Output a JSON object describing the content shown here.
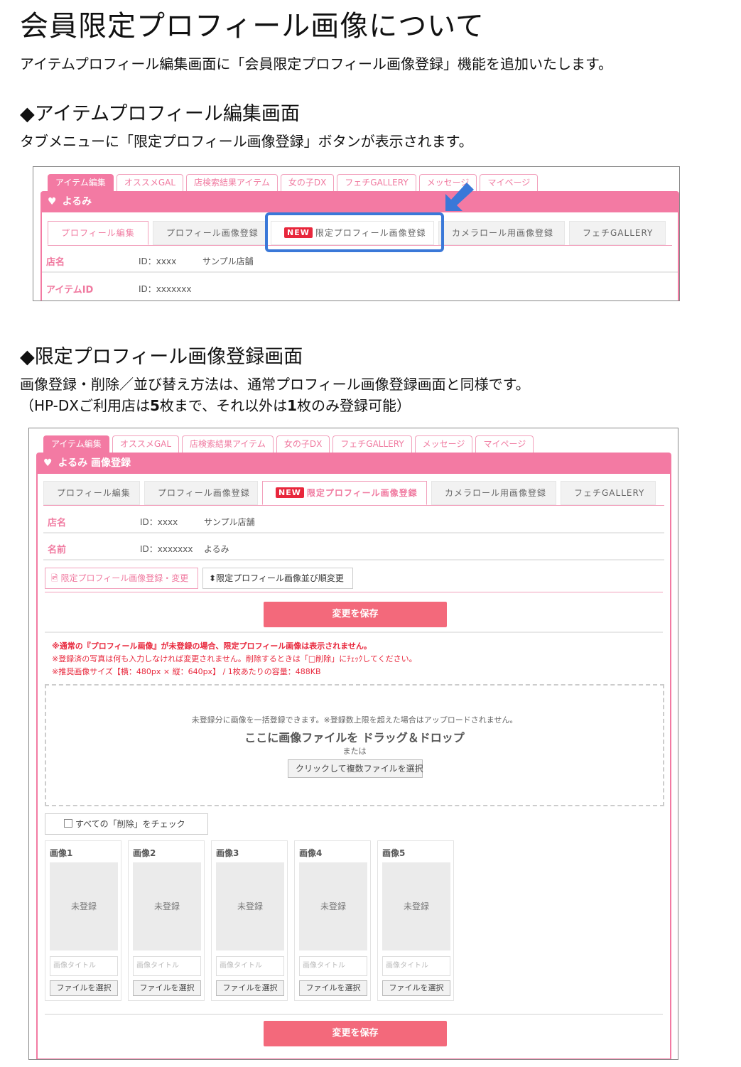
{
  "title": "会員限定プロフィール画像について",
  "intro": "アイテムプロフィール編集画面に「会員限定プロフィール画像登録」機能を追加いたします。",
  "section1": {
    "heading": "◆アイテムプロフィール編集画面",
    "desc": "タブメニューに「限定プロフィール画像登録」ボタンが表示されます。"
  },
  "section2": {
    "heading": "◆限定プロフィール画像登録画面",
    "desc1": "画像登録・削除／並び替え方法は、通常プロフィール画像登録画面と同様です。",
    "desc2_a": "（HP-DXご利用店は",
    "desc2_b": "5",
    "desc2_c": "枚まで、それ以外は",
    "desc2_d": "1",
    "desc2_e": "枚のみ登録可能）"
  },
  "main_tabs": [
    "アイテム編集",
    "オススメGAL",
    "店検索結果アイテム",
    "女の子DX",
    "フェチGALLERY",
    "メッセージ",
    "マイページ"
  ],
  "screen1": {
    "bar_title": "よるみ",
    "subtabs": [
      "プロフィール編集",
      "プロフィール画像登録",
      "限定プロフィール画像登録",
      "カメラロール用画像登録",
      "フェチGALLERY"
    ],
    "new_label": "NEW",
    "rows": [
      {
        "label": "店名",
        "v1": "ID：xxxx",
        "v2": "サンプル店舗"
      },
      {
        "label": "アイテムID",
        "v1": "ID：xxxxxxx",
        "v2": ""
      }
    ]
  },
  "screen2": {
    "bar_title": "よるみ 画像登録",
    "subtabs": [
      "プロフィール編集",
      "プロフィール画像登録",
      "限定プロフィール画像登録",
      "カメラロール用画像登録",
      "フェチGALLERY"
    ],
    "new_label": "NEW",
    "rows": [
      {
        "label": "店名",
        "v1": "ID：xxxx",
        "v2": "サンプル店舗"
      },
      {
        "label": "名前",
        "v1": "ID：xxxxxxx",
        "v2": "よるみ"
      }
    ],
    "btn_register": "限定プロフィール画像登録・変更",
    "btn_sort": "限定プロフィール画像並び順変更",
    "save": "変更を保存",
    "notes": [
      "※通常の『プロフィール画像』が未登録の場合、限定プロフィール画像は表示されません。",
      "※登録済の写真は何も入力しなければ変更されません。削除するときは「□削除」にﾁｪｯｸしてください。",
      "※推奨画像サイズ【横：480px × 縦：640px】 / 1枚あたりの容量：488KB"
    ],
    "dz_line1": "未登録分に画像を一括登録できます。※登録数上限を超えた場合はアップロードされません。",
    "dz_line2": "ここに画像ファイルを ドラッグ＆ドロップ",
    "dz_line3": "または",
    "dz_btn": "クリックして複数ファイルを選択",
    "check_all": "すべての「削除」をチェック",
    "cards": [
      {
        "title": "画像1",
        "status": "未登録"
      },
      {
        "title": "画像2",
        "status": "未登録"
      },
      {
        "title": "画像3",
        "status": "未登録"
      },
      {
        "title": "画像4",
        "status": "未登録"
      },
      {
        "title": "画像5",
        "status": "未登録"
      }
    ],
    "title_placeholder": "画像タイトル",
    "file_btn": "ファイルを選択"
  },
  "colors": {
    "pink": "#f37aa3",
    "red": "#e8273c",
    "blue_highlight": "#3a78d8",
    "save": "#f3697b"
  }
}
